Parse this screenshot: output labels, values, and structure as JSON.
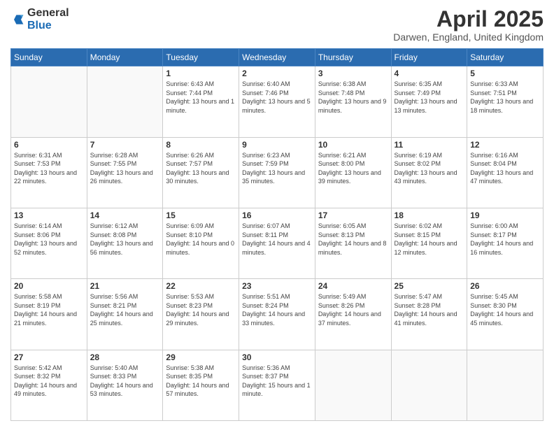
{
  "header": {
    "logo_general": "General",
    "logo_blue": "Blue",
    "month_title": "April 2025",
    "location": "Darwen, England, United Kingdom"
  },
  "calendar": {
    "days_of_week": [
      "Sunday",
      "Monday",
      "Tuesday",
      "Wednesday",
      "Thursday",
      "Friday",
      "Saturday"
    ],
    "weeks": [
      [
        {
          "day": "",
          "info": ""
        },
        {
          "day": "",
          "info": ""
        },
        {
          "day": "1",
          "info": "Sunrise: 6:43 AM\nSunset: 7:44 PM\nDaylight: 13 hours and 1 minute."
        },
        {
          "day": "2",
          "info": "Sunrise: 6:40 AM\nSunset: 7:46 PM\nDaylight: 13 hours and 5 minutes."
        },
        {
          "day": "3",
          "info": "Sunrise: 6:38 AM\nSunset: 7:48 PM\nDaylight: 13 hours and 9 minutes."
        },
        {
          "day": "4",
          "info": "Sunrise: 6:35 AM\nSunset: 7:49 PM\nDaylight: 13 hours and 13 minutes."
        },
        {
          "day": "5",
          "info": "Sunrise: 6:33 AM\nSunset: 7:51 PM\nDaylight: 13 hours and 18 minutes."
        }
      ],
      [
        {
          "day": "6",
          "info": "Sunrise: 6:31 AM\nSunset: 7:53 PM\nDaylight: 13 hours and 22 minutes."
        },
        {
          "day": "7",
          "info": "Sunrise: 6:28 AM\nSunset: 7:55 PM\nDaylight: 13 hours and 26 minutes."
        },
        {
          "day": "8",
          "info": "Sunrise: 6:26 AM\nSunset: 7:57 PM\nDaylight: 13 hours and 30 minutes."
        },
        {
          "day": "9",
          "info": "Sunrise: 6:23 AM\nSunset: 7:59 PM\nDaylight: 13 hours and 35 minutes."
        },
        {
          "day": "10",
          "info": "Sunrise: 6:21 AM\nSunset: 8:00 PM\nDaylight: 13 hours and 39 minutes."
        },
        {
          "day": "11",
          "info": "Sunrise: 6:19 AM\nSunset: 8:02 PM\nDaylight: 13 hours and 43 minutes."
        },
        {
          "day": "12",
          "info": "Sunrise: 6:16 AM\nSunset: 8:04 PM\nDaylight: 13 hours and 47 minutes."
        }
      ],
      [
        {
          "day": "13",
          "info": "Sunrise: 6:14 AM\nSunset: 8:06 PM\nDaylight: 13 hours and 52 minutes."
        },
        {
          "day": "14",
          "info": "Sunrise: 6:12 AM\nSunset: 8:08 PM\nDaylight: 13 hours and 56 minutes."
        },
        {
          "day": "15",
          "info": "Sunrise: 6:09 AM\nSunset: 8:10 PM\nDaylight: 14 hours and 0 minutes."
        },
        {
          "day": "16",
          "info": "Sunrise: 6:07 AM\nSunset: 8:11 PM\nDaylight: 14 hours and 4 minutes."
        },
        {
          "day": "17",
          "info": "Sunrise: 6:05 AM\nSunset: 8:13 PM\nDaylight: 14 hours and 8 minutes."
        },
        {
          "day": "18",
          "info": "Sunrise: 6:02 AM\nSunset: 8:15 PM\nDaylight: 14 hours and 12 minutes."
        },
        {
          "day": "19",
          "info": "Sunrise: 6:00 AM\nSunset: 8:17 PM\nDaylight: 14 hours and 16 minutes."
        }
      ],
      [
        {
          "day": "20",
          "info": "Sunrise: 5:58 AM\nSunset: 8:19 PM\nDaylight: 14 hours and 21 minutes."
        },
        {
          "day": "21",
          "info": "Sunrise: 5:56 AM\nSunset: 8:21 PM\nDaylight: 14 hours and 25 minutes."
        },
        {
          "day": "22",
          "info": "Sunrise: 5:53 AM\nSunset: 8:23 PM\nDaylight: 14 hours and 29 minutes."
        },
        {
          "day": "23",
          "info": "Sunrise: 5:51 AM\nSunset: 8:24 PM\nDaylight: 14 hours and 33 minutes."
        },
        {
          "day": "24",
          "info": "Sunrise: 5:49 AM\nSunset: 8:26 PM\nDaylight: 14 hours and 37 minutes."
        },
        {
          "day": "25",
          "info": "Sunrise: 5:47 AM\nSunset: 8:28 PM\nDaylight: 14 hours and 41 minutes."
        },
        {
          "day": "26",
          "info": "Sunrise: 5:45 AM\nSunset: 8:30 PM\nDaylight: 14 hours and 45 minutes."
        }
      ],
      [
        {
          "day": "27",
          "info": "Sunrise: 5:42 AM\nSunset: 8:32 PM\nDaylight: 14 hours and 49 minutes."
        },
        {
          "day": "28",
          "info": "Sunrise: 5:40 AM\nSunset: 8:33 PM\nDaylight: 14 hours and 53 minutes."
        },
        {
          "day": "29",
          "info": "Sunrise: 5:38 AM\nSunset: 8:35 PM\nDaylight: 14 hours and 57 minutes."
        },
        {
          "day": "30",
          "info": "Sunrise: 5:36 AM\nSunset: 8:37 PM\nDaylight: 15 hours and 1 minute."
        },
        {
          "day": "",
          "info": ""
        },
        {
          "day": "",
          "info": ""
        },
        {
          "day": "",
          "info": ""
        }
      ]
    ]
  }
}
